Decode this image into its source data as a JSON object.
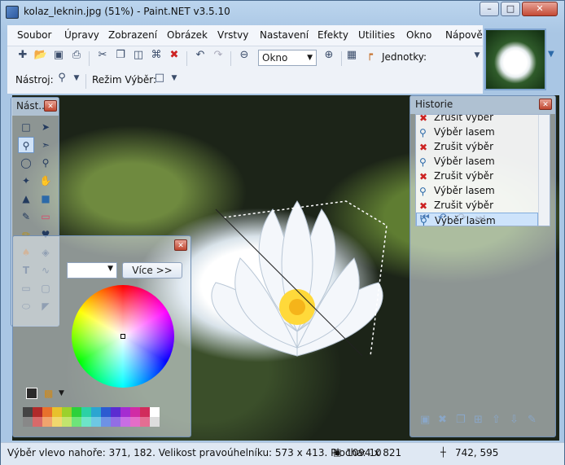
{
  "window": {
    "title": "kolaz_leknin.jpg (51%) - Paint.NET v3.5.10"
  },
  "menu": {
    "items": [
      "Soubor",
      "Úpravy",
      "Zobrazení",
      "Obrázek",
      "Vrstvy",
      "Nastavení",
      "Efekty",
      "Utilities",
      "Okno",
      "Nápově"
    ]
  },
  "toolbar": {
    "zoom_value": "Okno",
    "units_label": "Jednotky:",
    "tool_label": "Nástroj:",
    "selection_mode_label": "Režim Výběr:"
  },
  "tools_panel": {
    "title": "Nást..."
  },
  "history_panel": {
    "title": "Historie",
    "items": [
      {
        "label": "Zrušit výběr",
        "icon": "cancel-selection-icon"
      },
      {
        "label": "Výběr lasem",
        "icon": "lasso-icon"
      },
      {
        "label": "Zrušit výběr",
        "icon": "cancel-selection-icon"
      },
      {
        "label": "Výběr lasem",
        "icon": "lasso-icon"
      },
      {
        "label": "Zrušit výběr",
        "icon": "cancel-selection-icon"
      },
      {
        "label": "Výběr lasem",
        "icon": "lasso-icon"
      },
      {
        "label": "Zrušit výběr",
        "icon": "cancel-selection-icon"
      },
      {
        "label": "Výběr lasem",
        "icon": "lasso-icon"
      }
    ],
    "selected_index": 7
  },
  "colors_panel": {
    "more_button": "Více >>",
    "palette": [
      "#444444",
      "#b02a2a",
      "#e8712c",
      "#e8c12c",
      "#9bd12c",
      "#2cd13b",
      "#2cd1a5",
      "#2ca5d1",
      "#2c5bd1",
      "#5b2cd1",
      "#a52cd1",
      "#d12ca5",
      "#d12c5b",
      "#ffffff"
    ]
  },
  "statusbar": {
    "selection_info": "Výběr vlevo nahoře: 371, 182. Velikost pravoúhelníku: 573 x 413. Plocha: 10",
    "image_size": "1094 x 821",
    "cursor_pos": "742, 595"
  }
}
